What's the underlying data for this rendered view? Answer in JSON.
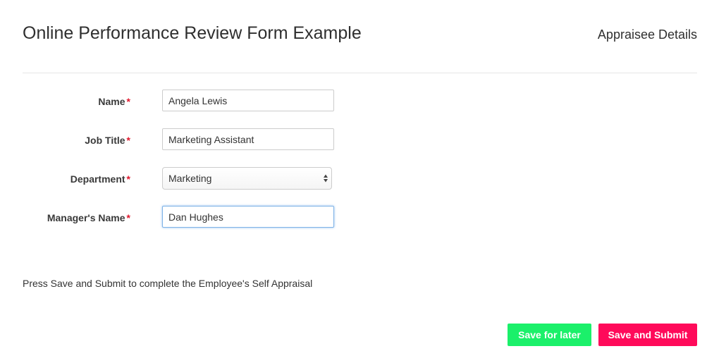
{
  "header": {
    "title": "Online Performance Review Form Example",
    "section": "Appraisee Details"
  },
  "form": {
    "required_mark": "*",
    "fields": [
      {
        "label": "Name",
        "value": "Angela Lewis"
      },
      {
        "label": "Job Title",
        "value": "Marketing Assistant"
      },
      {
        "label": "Department",
        "value": "Marketing"
      },
      {
        "label": "Manager's Name",
        "value": "Dan Hughes"
      }
    ]
  },
  "instruction": "Press Save and Submit to complete the Employee's Self Appraisal",
  "buttons": {
    "save_later": "Save for later",
    "save_submit": "Save and Submit"
  },
  "colors": {
    "required": "#e0182d",
    "save_later": "#1bf06a",
    "save_submit": "#ff0a5a",
    "focus": "#7fb3e6"
  }
}
